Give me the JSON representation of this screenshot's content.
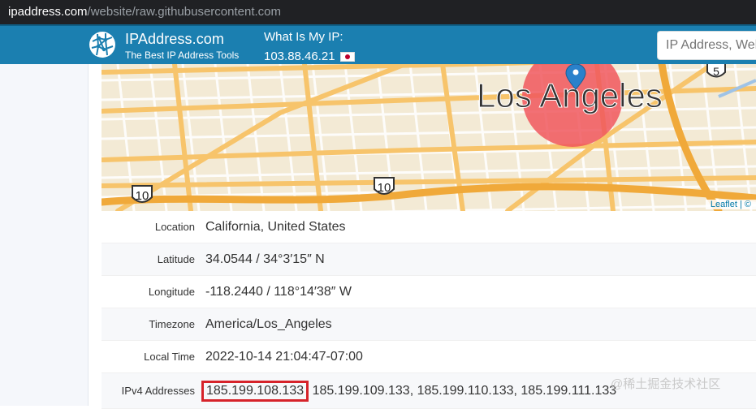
{
  "browser": {
    "url_host": "ipaddress.com",
    "url_path": "/website/raw.githubusercontent.com"
  },
  "header": {
    "brand_name": "IPAddress.com",
    "brand_tagline": "The Best IP Address Tools",
    "myip_label": "What Is My IP:",
    "myip_value": "103.88.46.21",
    "search_placeholder": "IP Address, Website"
  },
  "map": {
    "city_label": "Los Angeles",
    "route_shield_1": "10",
    "route_shield_2": "10",
    "route_shield_3": "5",
    "attribution": "Leaflet | ©"
  },
  "details": {
    "rows": [
      {
        "label": "Location",
        "value": "California, United States"
      },
      {
        "label": "Latitude",
        "value": "34.0544 / 34°3′15″ N"
      },
      {
        "label": "Longitude",
        "value": "-118.2440 / 118°14′38″ W"
      },
      {
        "label": "Timezone",
        "value": "America/Los_Angeles"
      },
      {
        "label": "Local Time",
        "value": "2022-10-14 21:04:47-07:00"
      }
    ],
    "ipv4_label": "IPv4 Addresses",
    "ipv4_highlighted": "185.199.108.133",
    "ipv4_rest": "185.199.109.133, 185.199.110.133, 185.199.111.133"
  },
  "watermark": "@稀土掘金技术社区",
  "colors": {
    "header_bg": "#1b7fb0",
    "highlight_border": "#d6232a",
    "marker": "#2a81cb"
  }
}
